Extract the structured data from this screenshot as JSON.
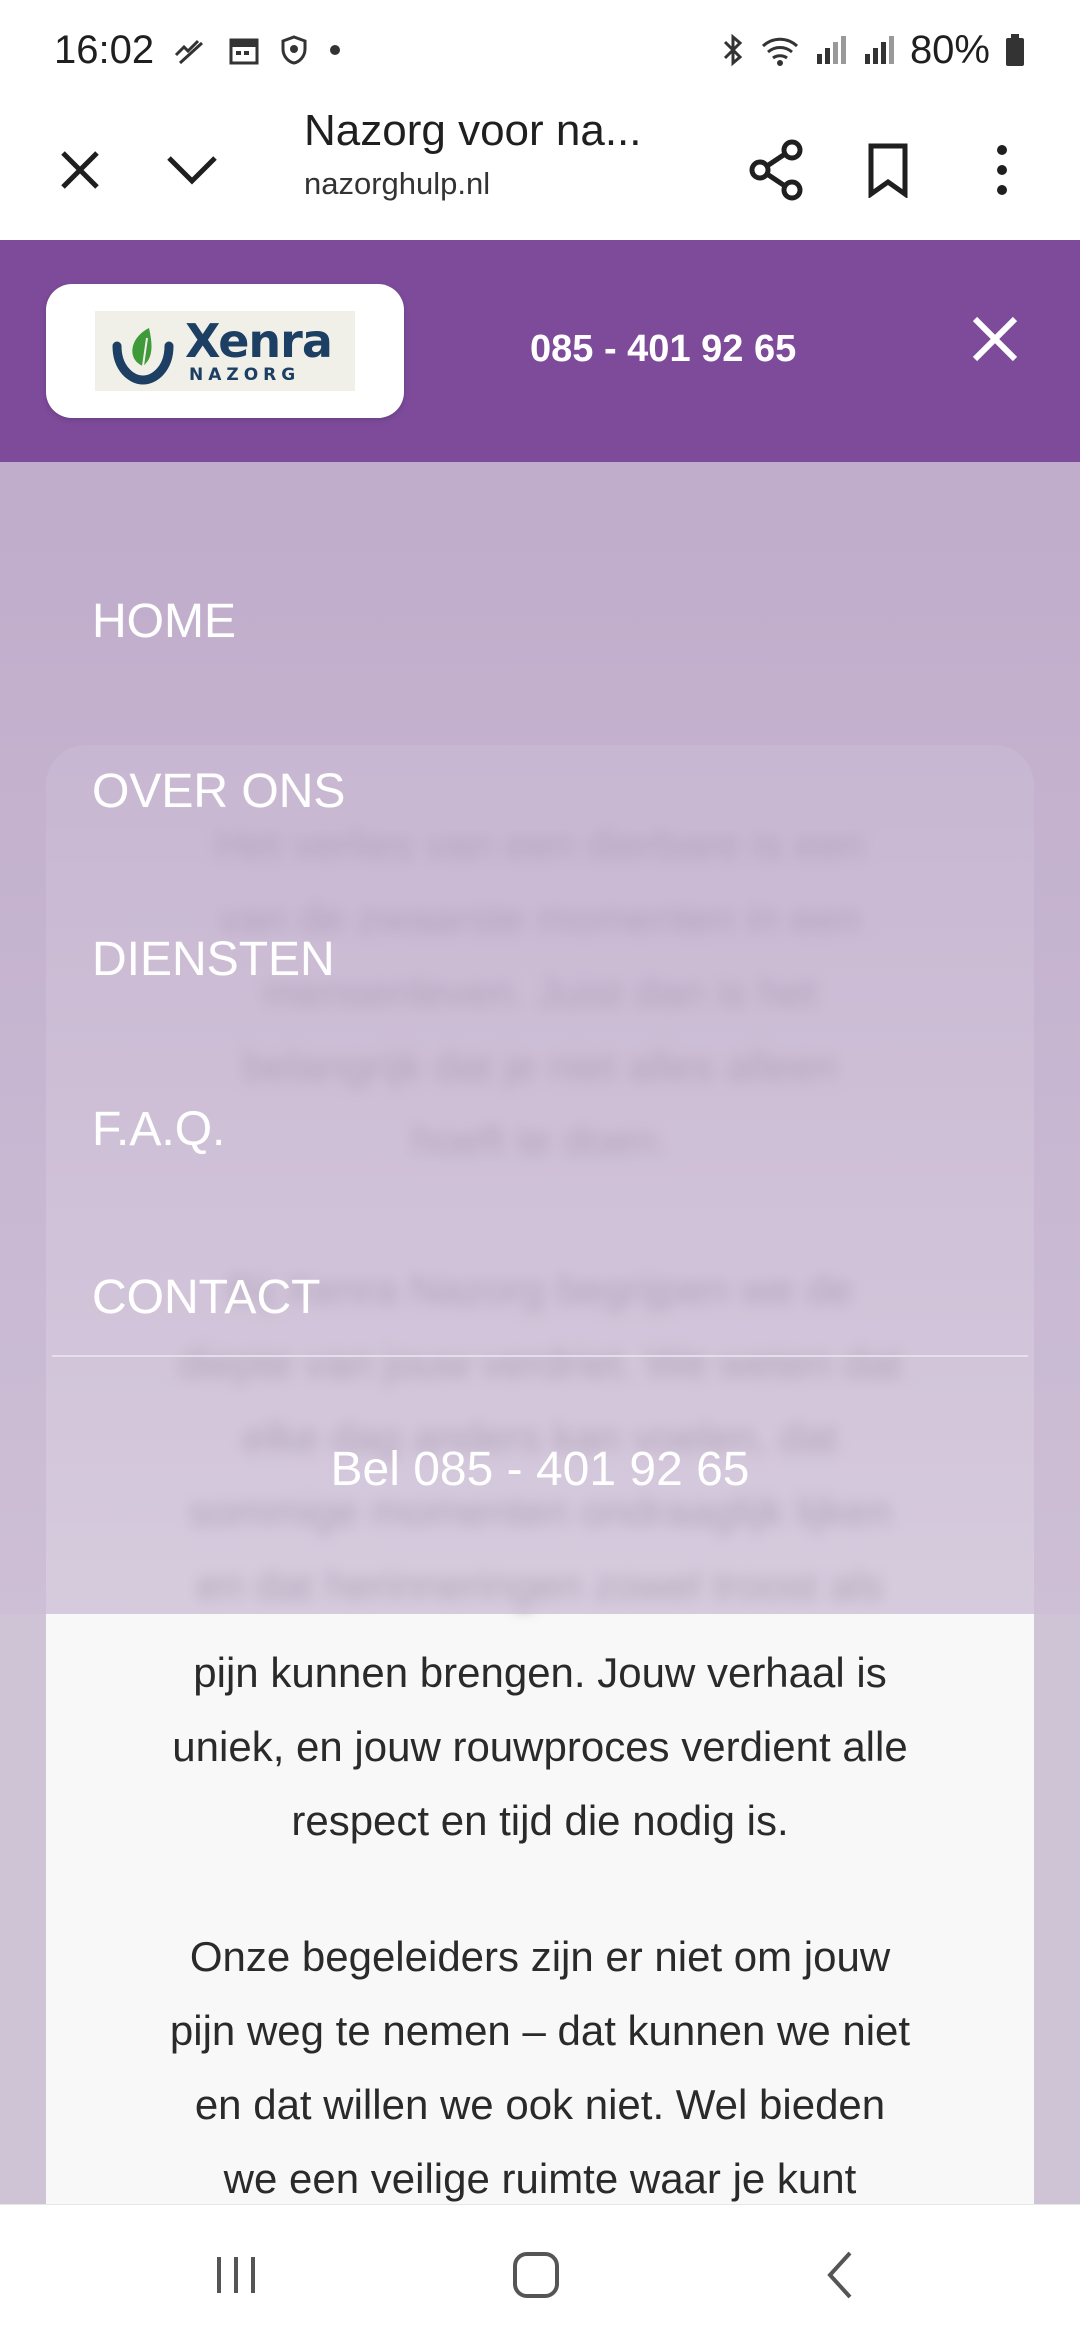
{
  "status_bar": {
    "time": "16:02",
    "battery": "80%",
    "left_icons": [
      "missed-call-icon",
      "calendar-icon",
      "shield-icon",
      "dot-icon"
    ],
    "right_icons": [
      "bluetooth-icon",
      "wifi-icon",
      "signal-icon",
      "signal-icon",
      "battery-icon"
    ]
  },
  "browser": {
    "title": "Nazorg voor na...",
    "url": "nazorghulp.nl"
  },
  "site": {
    "logo_name": "Xenra",
    "logo_sub": "NAZORG",
    "phone": "085 - 401 92 65",
    "brand_color": "#7d4b9a"
  },
  "menu": {
    "items": [
      "HOME",
      "OVER ONS",
      "DIENSTEN",
      "F.A.Q.",
      "CONTACT"
    ],
    "cta": "Bel 085 - 401 92 65"
  },
  "content": {
    "paragraph1": [
      "Het verlies van een dierbare is een",
      "van de zwaarste momenten in een",
      "mensenleven. Juist dan is het",
      "belangrijk dat je niet alles alleen",
      "hoeft te doen."
    ],
    "paragraph2_blurred": [
      "Bij Xenra Nazorg begrijpen we de",
      "diepte van jouw verdriet. We weten dat",
      "elke dag anders kan voelen, dat",
      "sommige momenten ondraaglijk lijken",
      "en dat herinneringen zowel troost als"
    ],
    "paragraph2_visible": [
      "pijn kunnen brengen. Jouw verhaal is",
      "uniek, en jouw rouwproces verdient alle",
      "respect en tijd die nodig is."
    ],
    "paragraph3": [
      "Onze begeleiders zijn er niet om jouw",
      "pijn weg te nemen – dat kunnen we niet",
      "en dat willen we ook niet. Wel bieden",
      "we een veilige ruimte waar je kunt"
    ]
  }
}
